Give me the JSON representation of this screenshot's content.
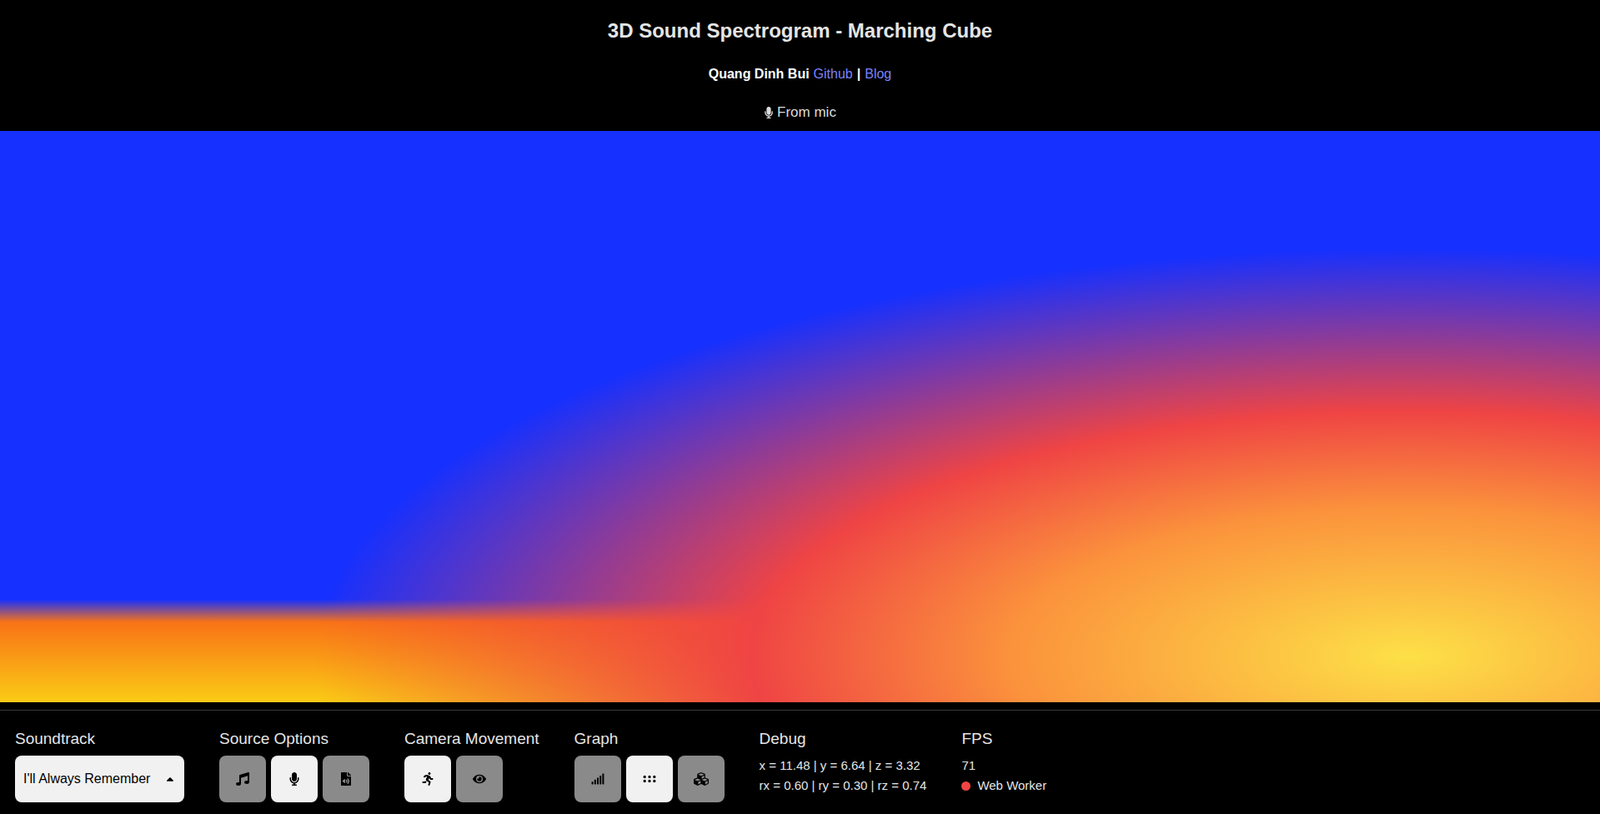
{
  "header": {
    "title": "3D Sound Spectrogram - Marching Cube",
    "author": "Quang Dinh Bui",
    "links": [
      "Github",
      "Blog"
    ],
    "separator": "|",
    "source_label": "From mic"
  },
  "controls": {
    "soundtrack": {
      "label": "Soundtrack",
      "value": "I'll Always Remember",
      "expanded": false
    },
    "source_options": {
      "label": "Source Options",
      "buttons": [
        {
          "selected": false
        },
        {
          "selected": true
        },
        {
          "selected": false
        }
      ]
    },
    "camera_movement": {
      "label": "Camera Movement",
      "buttons": [
        {
          "selected": true
        },
        {
          "selected": false
        }
      ]
    },
    "graph": {
      "label": "Graph",
      "buttons": [
        {
          "selected": false
        },
        {
          "selected": true
        },
        {
          "selected": false
        }
      ]
    },
    "debug": {
      "label": "Debug",
      "lines": [
        "x = 11.48 | y = 6.64 | z = 3.32",
        "rx = 0.60 | ry = 0.30 | rz = 0.74"
      ]
    },
    "fps": {
      "label": "FPS",
      "value": "71",
      "worker": {
        "label": "Web Worker",
        "color": "#ef4444"
      }
    }
  }
}
